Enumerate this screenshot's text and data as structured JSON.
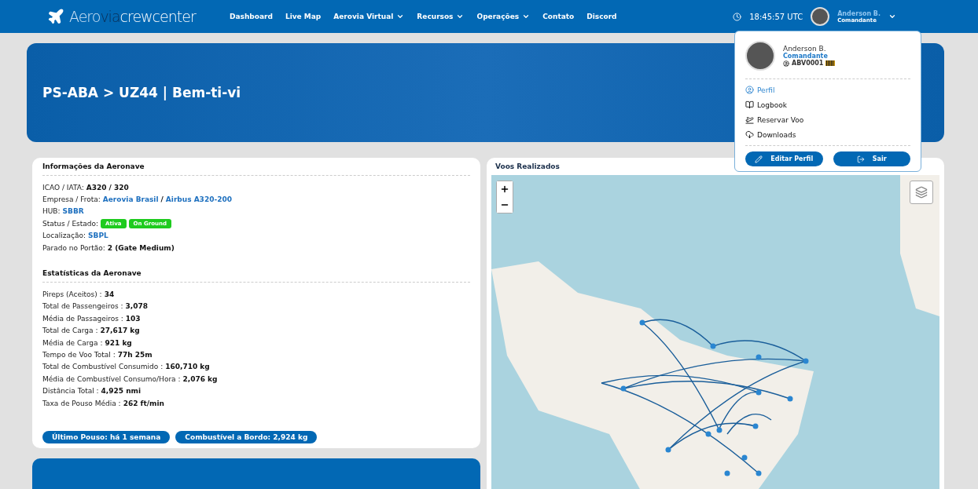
{
  "header": {
    "logo": {
      "part_1": "Aero",
      "part_2": "via",
      "part_3": "crewcenter"
    },
    "nav": [
      {
        "label": "Dashboard",
        "dropdown": false
      },
      {
        "label": "Live Map",
        "dropdown": false
      },
      {
        "label": "Aerovia Virtual",
        "dropdown": true
      },
      {
        "label": "Recursos",
        "dropdown": true
      },
      {
        "label": "Operações",
        "dropdown": true
      },
      {
        "label": "Contato",
        "dropdown": false
      },
      {
        "label": "Discord",
        "dropdown": false
      }
    ],
    "clock": "18:45:57 UTC",
    "user": {
      "name": "Anderson B.",
      "rank": "Comandante"
    }
  },
  "user_menu": {
    "name": "Anderson B.",
    "rank": "Comandante",
    "pilot_id": "ABV0001",
    "items": [
      {
        "label": "Perfil",
        "selected": true
      },
      {
        "label": "Logbook",
        "selected": false
      },
      {
        "label": "Reservar Voo",
        "selected": false
      },
      {
        "label": "Downloads",
        "selected": false
      }
    ],
    "buttons": [
      "Editar Perfil",
      "Sair"
    ]
  },
  "hero": {
    "title": "PS-ABA > UZ44 | Bem-ti-vi"
  },
  "aircraft_info": {
    "title": "Informações da Aeronave",
    "rows": [
      {
        "kind": "text",
        "label": "ICAO / IATA:",
        "value": "A320 / 320"
      },
      {
        "kind": "links",
        "label": "Empresa / Frota:",
        "links": [
          "Aerovia Brasil",
          "Airbus A320-200"
        ],
        "separator": "/"
      },
      {
        "kind": "links",
        "label": "HUB:",
        "links": [
          "SBBR"
        ]
      },
      {
        "kind": "badges",
        "label": "Status / Estado:",
        "badges": [
          "Ativa",
          "On Ground"
        ]
      },
      {
        "kind": "links",
        "label": "Localização:",
        "links": [
          "SBPL"
        ]
      },
      {
        "kind": "text",
        "label": "Parado no Portão:",
        "value": "2 (Gate Medium)"
      }
    ]
  },
  "stats": {
    "title": "Estatísticas da Aeronave",
    "rows": [
      {
        "label": "Pireps (Aceitos) :",
        "value": "34"
      },
      {
        "label": "Total de Passengeiros :",
        "value": "3,078"
      },
      {
        "label": "Média de Passageiros :",
        "value": "103"
      },
      {
        "label": "Total de Carga :",
        "value": "27,617 kg"
      },
      {
        "label": "Média de Carga :",
        "value": "921 kg"
      },
      {
        "label": "Tempo de Voo Total :",
        "value": "77h 25m"
      },
      {
        "label": "Total de Combustível Consumido :",
        "value": "160,710 kg"
      },
      {
        "label": "Média de Combustível Consumo/Hora :",
        "value": "2,076 kg"
      },
      {
        "label": "Distância Total :",
        "value": "4,925 nmi"
      },
      {
        "label": "Taxa de Pouso Média :",
        "value": "262 ft/min"
      }
    ],
    "pills": [
      "Último Pouso: há 1 semana",
      "Combustível a Bordo: 2,924 kg"
    ]
  },
  "flights": {
    "title": "Voos Realizados"
  }
}
